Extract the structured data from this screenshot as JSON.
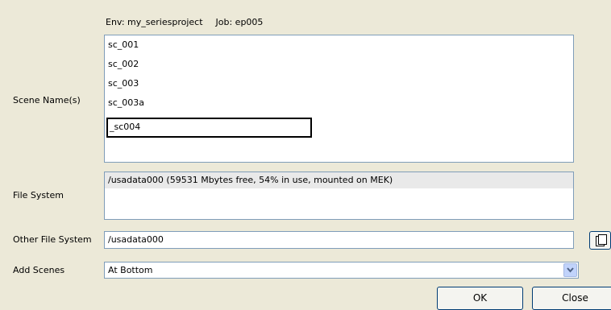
{
  "header": {
    "env_label": "Env: my_seriesproject",
    "job_label": "Job: ep005"
  },
  "scene_names": {
    "label": "Scene Name(s)",
    "items": [
      "sc_001",
      "sc_002",
      "sc_003",
      "sc_003a"
    ],
    "edit_value": "_sc004"
  },
  "file_system": {
    "label": "File System",
    "entry": "/usadata000  (59531 Mbytes free, 54% in use, mounted on MEK)"
  },
  "other_file_system": {
    "label": "Other File System",
    "value": "/usadata000",
    "browse_icon": "browse-window-icon"
  },
  "add_scenes": {
    "label": "Add Scenes",
    "selected": "At Bottom",
    "arrow_icon": "chevron-down-icon"
  },
  "buttons": {
    "ok_label": "OK",
    "close_label": "Close"
  }
}
